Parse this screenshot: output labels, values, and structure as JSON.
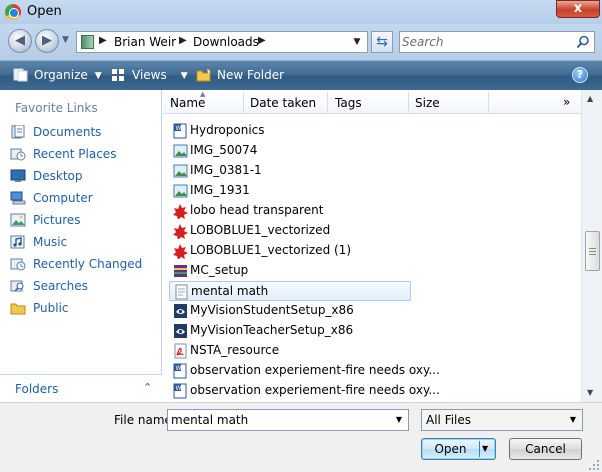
{
  "window": {
    "title": "Open",
    "close_glyph": "x"
  },
  "address_bar": {
    "breadcrumbs": [
      "Brian Weir",
      "Downloads"
    ],
    "separator_glyph": "▶",
    "dropdown_glyph": "▼",
    "search_placeholder": "Search",
    "back_glyph": "◀",
    "forward_glyph": "▶",
    "recent_glyph": "▼",
    "refresh_glyph": "⇆"
  },
  "toolbar": {
    "organize_label": "Organize",
    "views_label": "Views",
    "new_folder_label": "New Folder",
    "caret_glyph": "▼",
    "help_glyph": "?"
  },
  "navigation_pane": {
    "heading": "Favorite Links",
    "links": [
      {
        "label": "Documents",
        "icon": "documents-icon"
      },
      {
        "label": "Recent Places",
        "icon": "recent-places-icon"
      },
      {
        "label": "Desktop",
        "icon": "desktop-icon"
      },
      {
        "label": "Computer",
        "icon": "computer-icon"
      },
      {
        "label": "Pictures",
        "icon": "pictures-icon"
      },
      {
        "label": "Music",
        "icon": "music-icon"
      },
      {
        "label": "Recently Changed",
        "icon": "recently-changed-icon"
      },
      {
        "label": "Searches",
        "icon": "searches-icon"
      },
      {
        "label": "Public",
        "icon": "public-icon"
      }
    ],
    "folders_label": "Folders",
    "folders_chevron": "⌃"
  },
  "file_list": {
    "columns": [
      "Name",
      "Date taken",
      "Tags",
      "Size"
    ],
    "more_columns_glyph": "»",
    "sort_glyph": "▲",
    "files": [
      {
        "name": "Hydroponics",
        "type": "doc"
      },
      {
        "name": "IMG_50074",
        "type": "image"
      },
      {
        "name": "IMG_0381-1",
        "type": "image"
      },
      {
        "name": "IMG_1931",
        "type": "image"
      },
      {
        "name": "lobo head transparent",
        "type": "vector"
      },
      {
        "name": "LOBOBLUE1_vectorized",
        "type": "vector"
      },
      {
        "name": "LOBOBLUE1_vectorized (1)",
        "type": "vector"
      },
      {
        "name": "MC_setup",
        "type": "archive"
      },
      {
        "name": "mental math",
        "type": "text",
        "selected": true
      },
      {
        "name": "MyVisionStudentSetup_x86",
        "type": "setup"
      },
      {
        "name": "MyVisionTeacherSetup_x86",
        "type": "setup"
      },
      {
        "name": "NSTA_resource",
        "type": "pdf"
      },
      {
        "name": "observation experiement-fire needs oxy...",
        "type": "doc"
      },
      {
        "name": "observation experiement-fire needs oxy...",
        "type": "doc"
      }
    ]
  },
  "bottom_bar": {
    "file_name_label": "File name:",
    "file_name_value": "mental math",
    "file_type_value": "All Files",
    "open_label": "Open",
    "cancel_label": "Cancel",
    "dropdown_glyph": "▼"
  },
  "colors": {
    "toolbar": "#3d6890",
    "link": "#1f5fa8",
    "selection_border": "#a9c9ee"
  }
}
